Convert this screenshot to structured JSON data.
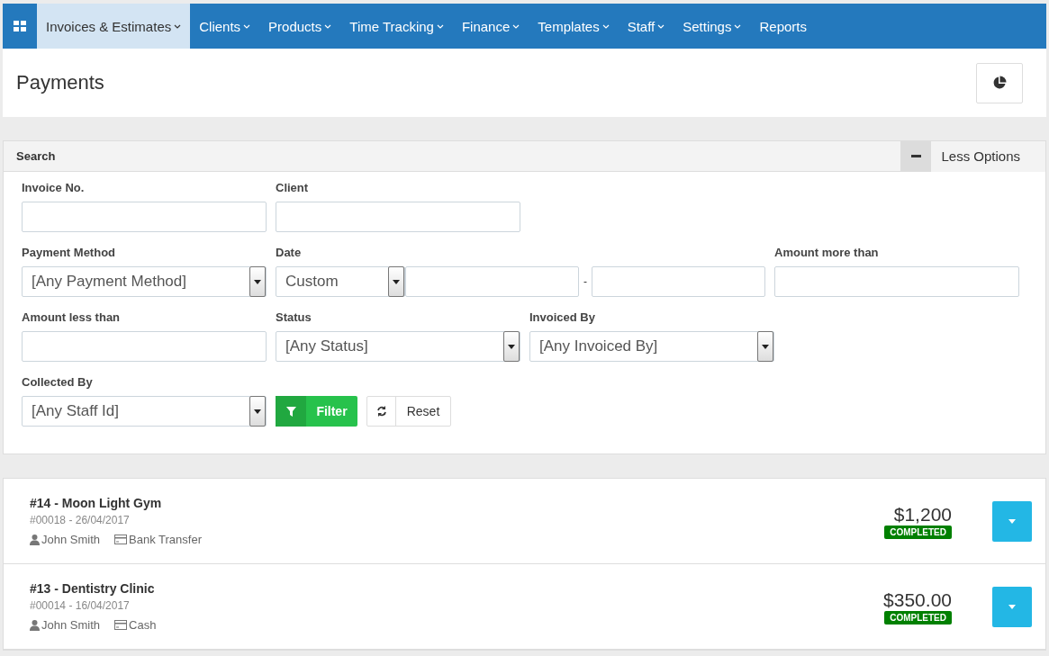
{
  "nav": {
    "items": [
      {
        "label": "Invoices & Estimates",
        "selected": true,
        "dropdown": true
      },
      {
        "label": "Clients",
        "selected": false,
        "dropdown": true
      },
      {
        "label": "Products",
        "selected": false,
        "dropdown": true
      },
      {
        "label": "Time Tracking",
        "selected": false,
        "dropdown": true
      },
      {
        "label": "Finance",
        "selected": false,
        "dropdown": true
      },
      {
        "label": "Templates",
        "selected": false,
        "dropdown": true
      },
      {
        "label": "Staff",
        "selected": false,
        "dropdown": true
      },
      {
        "label": "Settings",
        "selected": false,
        "dropdown": true
      },
      {
        "label": "Reports",
        "selected": false,
        "dropdown": false
      }
    ]
  },
  "page": {
    "title": "Payments"
  },
  "search": {
    "title": "Search",
    "toggle_label": "Less Options",
    "rows": [
      [
        {
          "kind": "text",
          "label": "Invoice No."
        },
        {
          "kind": "text",
          "label": "Client"
        }
      ],
      [
        {
          "kind": "select",
          "label": "Payment Method",
          "value": "[Any Payment Method]"
        },
        {
          "kind": "daterange",
          "label": "Date",
          "value": "Custom",
          "separator": "-"
        },
        {
          "kind": "text",
          "label": "Amount more than"
        }
      ],
      [
        {
          "kind": "text",
          "label": "Amount less than"
        },
        {
          "kind": "select",
          "label": "Status",
          "value": "[Any Status]"
        },
        {
          "kind": "select",
          "label": "Invoiced By",
          "value": "[Any Invoiced By]"
        }
      ],
      [
        {
          "kind": "select",
          "label": "Collected By",
          "value": "[Any Staff Id]"
        }
      ]
    ],
    "filter_label": "Filter",
    "reset_label": "Reset"
  },
  "payments": [
    {
      "title": "#14 - Moon Light Gym",
      "ref": "#00018 - 26/04/2017",
      "person": "John Smith",
      "method": "Bank Transfer",
      "amount": "$1,200",
      "status": "COMPLETED"
    },
    {
      "title": "#13 - Dentistry Clinic",
      "ref": "#00014 - 16/04/2017",
      "person": "John Smith",
      "method": "Cash",
      "amount": "$350.00",
      "status": "COMPLETED"
    }
  ]
}
